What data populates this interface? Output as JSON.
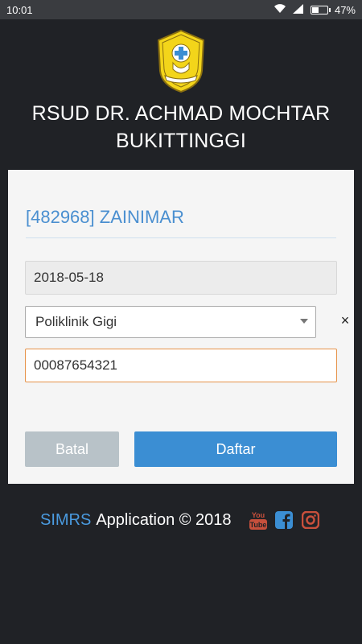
{
  "status_bar": {
    "time": "10:01",
    "battery": "47%"
  },
  "header": {
    "title_line1": "RSUD DR. ACHMAD MOCHTAR",
    "title_line2": "BUKITTINGGI"
  },
  "form": {
    "patient_label": "[482968] ZAINIMAR",
    "date_value": "2018-05-18",
    "clinic_value": "Poliklinik Gigi",
    "clear_symbol": "×",
    "phone_value": "00087654321",
    "cancel_label": "Batal",
    "submit_label": "Daftar"
  },
  "footer": {
    "brand": "SIMRS",
    "text": "Application © 2018",
    "youtube_label": "You Tube"
  },
  "colors": {
    "accent": "#3b8ed3",
    "focus_border": "#e69248",
    "social_icon": "#c8503c",
    "facebook_icon": "#3b8ed3"
  }
}
